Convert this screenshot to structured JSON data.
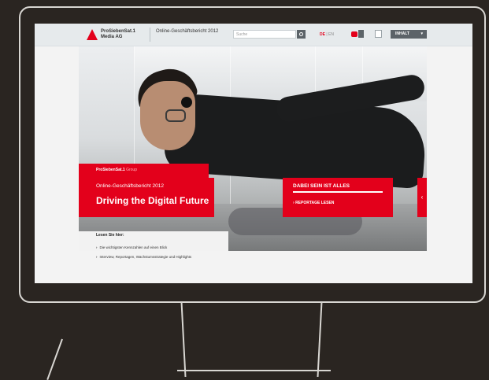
{
  "header": {
    "company": "ProSiebenSat.1 Media AG",
    "report": "Online-Geschäftsbericht 2012",
    "search_placeholder": "Suche",
    "lang_de": "DE",
    "lang_sep": "|",
    "lang_en": "EN",
    "menu_label": "INHALT"
  },
  "hero": {
    "brand": "ProSiebenSat.1",
    "brand_group": "Group",
    "subtitle": "Online-Geschäftsbericht 2012",
    "title": "Driving the Digital Future",
    "promo_title": "DABEI SEIN IST ALLES",
    "promo_link": "REPORTAGE LESEN"
  },
  "read": {
    "heading": "Lesen Sie hier:",
    "items": [
      "Die wichtigsten Kennzahlen auf einen Blick",
      "Interview, Reportagen, Wachstumsstrategie und Highlights"
    ]
  },
  "colors": {
    "brand_red": "#e3001b",
    "background": "#2a2521"
  }
}
